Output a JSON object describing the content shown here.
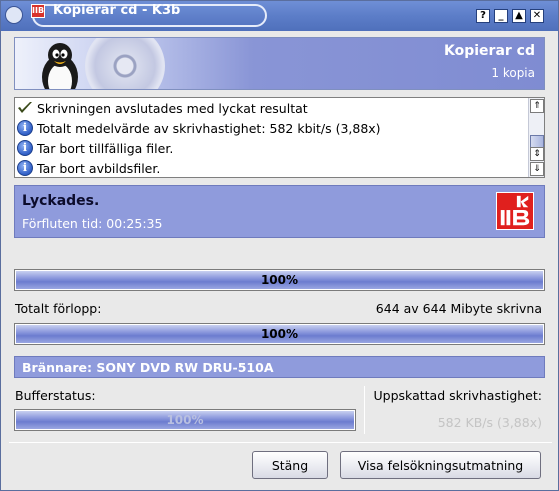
{
  "window": {
    "title": "Kopierar cd - K3b",
    "app_icon_label": "IIB",
    "buttons": {
      "help": "?",
      "minimize": "_",
      "maximize": "▲",
      "close": "✕"
    }
  },
  "banner": {
    "title": "Kopierar cd",
    "subtitle": "1 kopia"
  },
  "log": {
    "items": [
      {
        "icon": "checkmark-icon",
        "text": "Skrivningen avslutades med lyckat resultat"
      },
      {
        "icon": "info-icon",
        "text": "Totalt medelvärde av skrivhastighet: 582 kbit/s (3,88x)"
      },
      {
        "icon": "info-icon",
        "text": "Tar bort tillfälliga filer."
      },
      {
        "icon": "info-icon",
        "text": "Tar bort avbildsfiler."
      }
    ]
  },
  "status": {
    "title": "Lyckades.",
    "elapsed": "Förfluten tid: 00:25:35"
  },
  "progress": {
    "track": {
      "percent": 100,
      "label": "100%"
    },
    "total_label": "Totalt förlopp:",
    "total_info": "644 av 644 Mibyte skrivna",
    "total": {
      "percent": 100,
      "label": "100%"
    }
  },
  "burner": {
    "label": "Brännare: SONY DVD RW DRU-510A"
  },
  "buffer": {
    "label": "Bufferstatus:",
    "percent": 100,
    "bar_label": "100%"
  },
  "speed": {
    "label": "Uppskattad skrivhastighet:",
    "value": "582 KB/s (3,88x)"
  },
  "actions": {
    "close": "Stäng",
    "debug": "Visa felsökningsutmatning"
  },
  "colors": {
    "accent": "#8f9bdc",
    "titlebar": "#5c7dc8"
  }
}
